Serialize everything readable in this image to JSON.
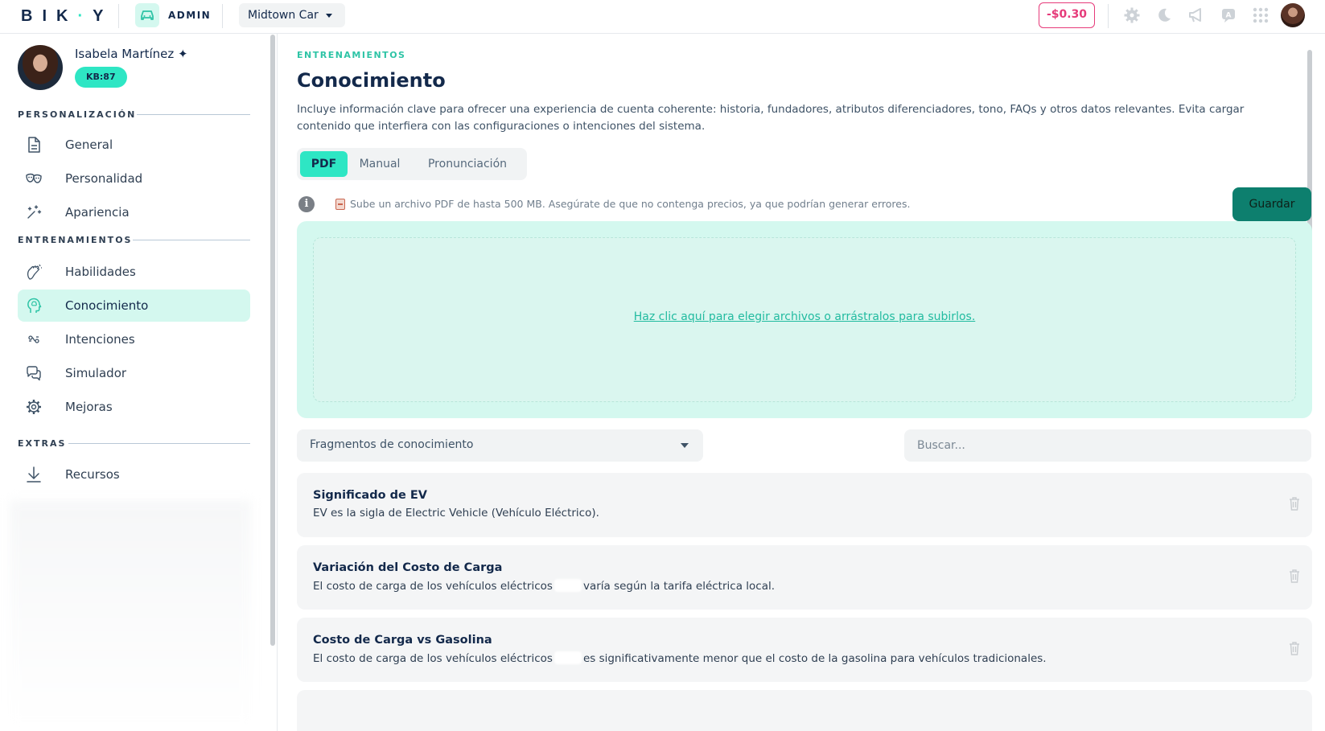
{
  "header": {
    "logo": "BIKY",
    "admin_label": "ADMIN",
    "company": "Midtown Car",
    "balance": "-$0.30",
    "icons": [
      "gear-icon",
      "moon-icon",
      "megaphone-icon",
      "chat-icon",
      "apps-grid-icon",
      "user-avatar"
    ]
  },
  "profile": {
    "name": "Isabela Martínez ✦",
    "kb_badge": "KB:87"
  },
  "sidebar": {
    "sections": [
      {
        "title": "PERSONALIZACIÓN",
        "items": [
          {
            "label": "General",
            "icon": "document-icon",
            "active": false
          },
          {
            "label": "Personalidad",
            "icon": "masks-icon",
            "active": false
          },
          {
            "label": "Apariencia",
            "icon": "sparkle-icon",
            "active": false
          }
        ]
      },
      {
        "title": "ENTRENAMIENTOS",
        "items": [
          {
            "label": "Habilidades",
            "icon": "clap-icon",
            "active": false
          },
          {
            "label": "Conocimiento",
            "icon": "head-icon",
            "active": true
          },
          {
            "label": "Intenciones",
            "icon": "intent-icon",
            "active": false
          },
          {
            "label": "Simulador",
            "icon": "chat-bubbles-icon",
            "active": false
          },
          {
            "label": "Mejoras",
            "icon": "gear-icon",
            "active": false
          }
        ]
      },
      {
        "title": "EXTRAS",
        "items": [
          {
            "label": "Recursos",
            "icon": "download-icon",
            "active": false
          }
        ]
      }
    ]
  },
  "main": {
    "eyebrow": "ENTRENAMIENTOS",
    "title": "Conocimiento",
    "description": "Incluye información clave para ofrecer una experiencia de cuenta coherente: historia, fundadores, atributos diferenciadores, tono, FAQs y otros datos relevantes. Evita cargar contenido que interfiera con las configuraciones o intenciones del sistema.",
    "tabs": [
      {
        "label": "PDF",
        "active": true
      },
      {
        "label": "Manual",
        "active": false
      },
      {
        "label": "Pronunciación",
        "active": false
      }
    ],
    "info_text": "Sube un archivo PDF de hasta 500 MB. Asegúrate de que no contenga precios, ya que podrían generar errores.",
    "save_label": "Guardar",
    "drop_text": "Haz clic aquí para elegir archivos o arrástralos para subirlos.",
    "fragments_select": "Fragmentos de conocimiento",
    "search_placeholder": "Buscar...",
    "cards": [
      {
        "title": "Significado de EV",
        "text_before": "EV es la sigla de Electric Vehicle (Vehículo Eléctrico).",
        "text_after": ""
      },
      {
        "title": "Variación del Costo de Carga",
        "text_before": "El costo de carga de los vehículos eléctricos",
        "text_after": "varía según la tarifa eléctrica local."
      },
      {
        "title": "Costo de Carga vs Gasolina",
        "text_before": "El costo de carga de los vehículos eléctricos",
        "text_after": "es significativamente menor que el costo de la gasolina para vehículos tradicionales."
      }
    ]
  },
  "colors": {
    "accent": "#2ee6c4",
    "accent_light": "#d4f8ef",
    "navy": "#13294b",
    "save_button": "#0d7f6e",
    "balance": "#e63b7a"
  }
}
